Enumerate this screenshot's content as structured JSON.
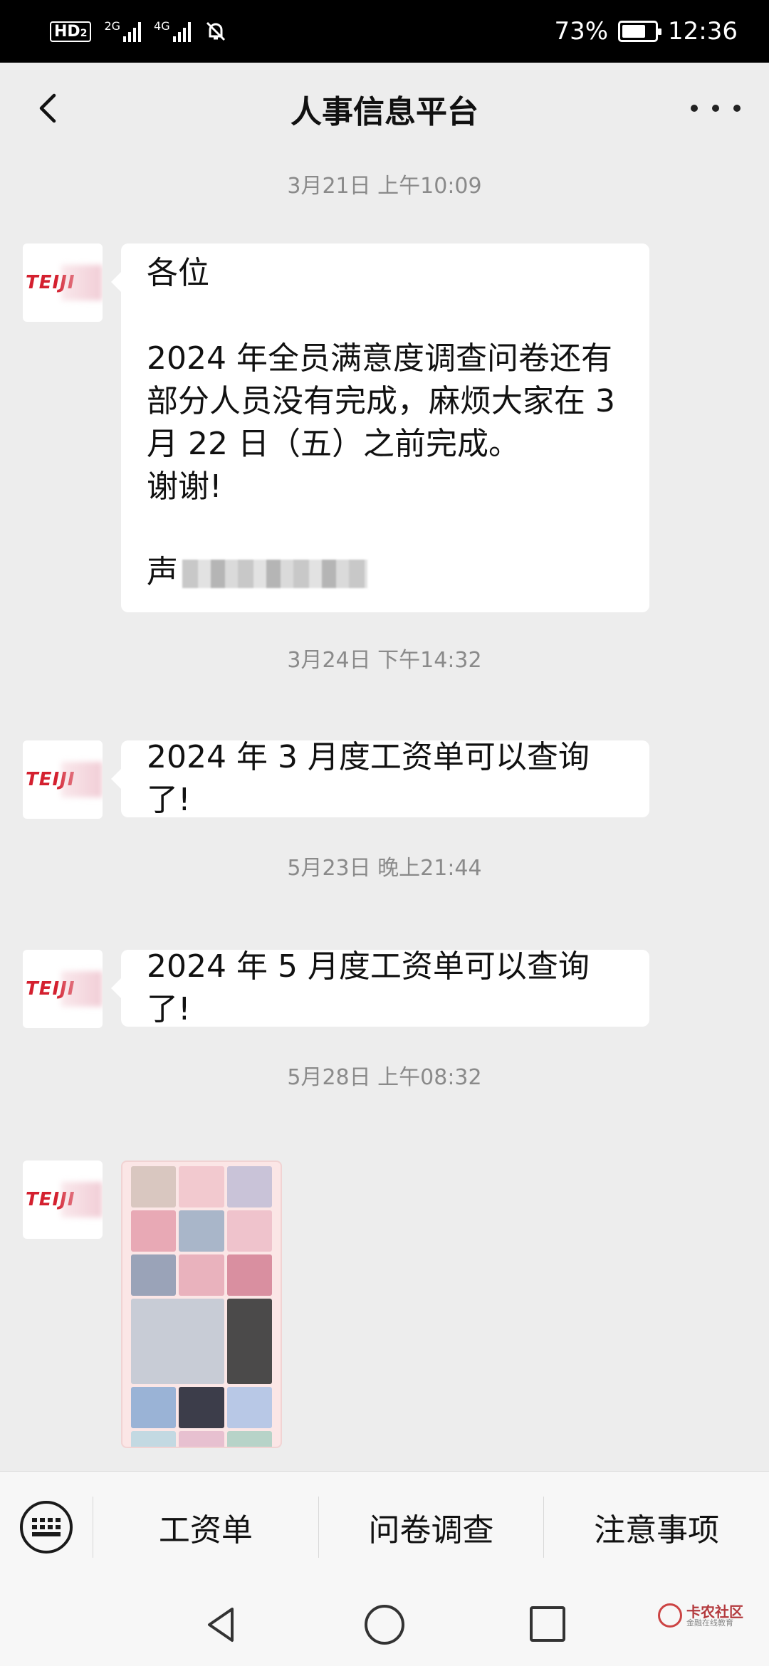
{
  "status_bar": {
    "hd_label": "HD",
    "hd_sub": "2",
    "net1": "2G",
    "net2": "4G",
    "battery_percent": "73%",
    "battery_level": 0.73,
    "time": "12:36"
  },
  "header": {
    "title": "人事信息平台"
  },
  "messages": [
    {
      "timestamp": "3月21日 上午10:09",
      "sender_logo": "TEIJI",
      "lines": [
        "各位",
        "",
        "2024 年全员满意度调查问卷还有",
        "部分人员没有完成，麻烦大家在 3",
        "月 22 日（五）之前完成。",
        "谢谢!",
        ""
      ],
      "signature_prefix": "声"
    },
    {
      "timestamp": "3月24日 下午14:32",
      "sender_logo": "TEIJI",
      "text": "2024 年 3 月度工资单可以查询了!"
    },
    {
      "timestamp": "5月23日 晚上21:44",
      "sender_logo": "TEIJI",
      "text": "2024 年 5 月度工资单可以查询了!"
    },
    {
      "timestamp": "5月28日 上午08:32",
      "sender_logo": "TEIJI"
    }
  ],
  "bottom_menu": {
    "items": [
      "工资单",
      "问卷调查",
      "注意事项"
    ]
  },
  "watermark": {
    "main": "卡农社区",
    "sub": "金融在线教育"
  },
  "colors": {
    "background": "#ededed",
    "bubble": "#ffffff",
    "logo_red": "#d4202f",
    "status_bar": "#000000"
  }
}
